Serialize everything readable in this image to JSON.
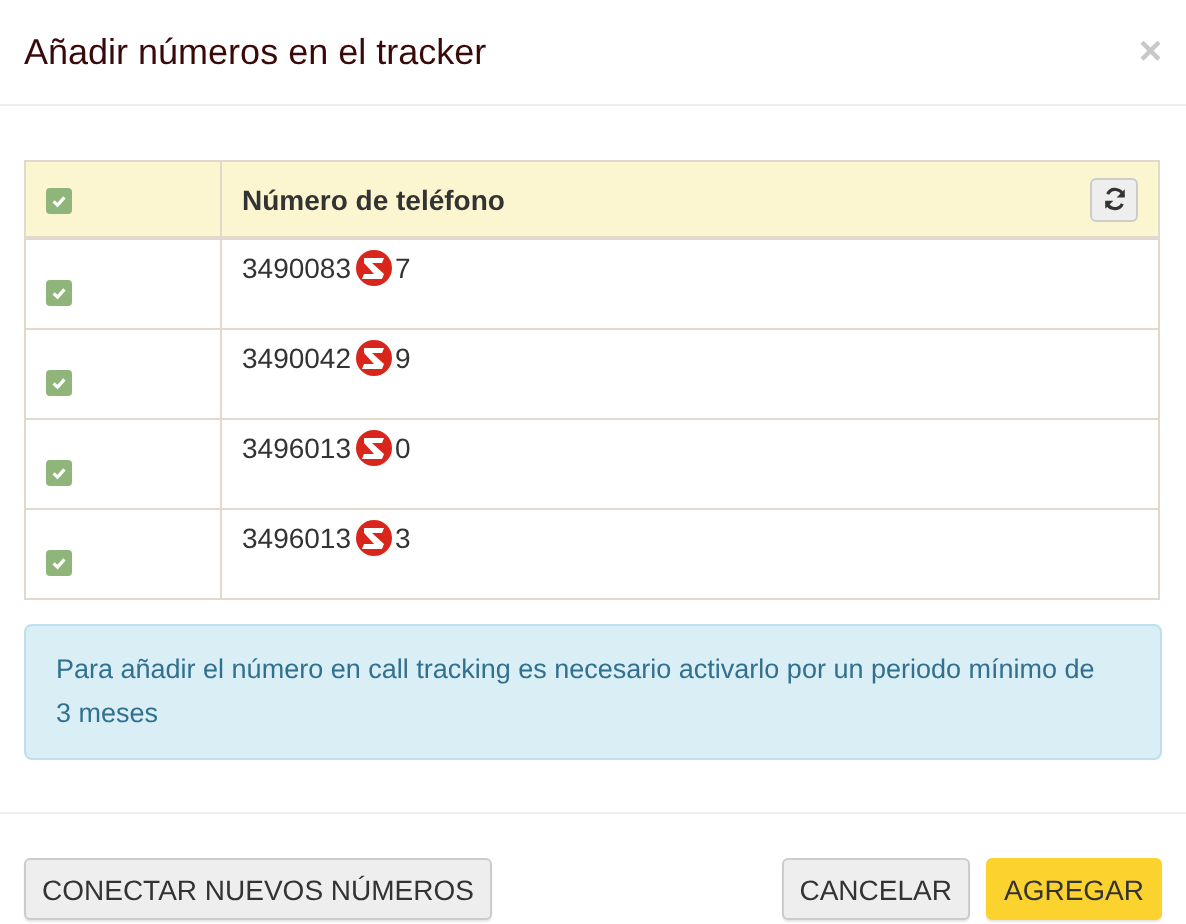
{
  "dialog": {
    "title": "Añadir números en el tracker",
    "close": "×"
  },
  "table": {
    "select_all_checked": true,
    "column_header": "Número de teléfono",
    "rows": [
      {
        "checked": true,
        "number_start": "3490083",
        "number_end": "7"
      },
      {
        "checked": true,
        "number_start": "3490042",
        "number_end": "9"
      },
      {
        "checked": true,
        "number_start": "3496013",
        "number_end": "0"
      },
      {
        "checked": true,
        "number_start": "3496013",
        "number_end": "3"
      }
    ]
  },
  "alert": "Para añadir el número en call tracking es necesario activarlo por un periodo mínimo de 3 meses",
  "buttons": [
    {
      "label": "CONECTAR NUEVOS NÚMEROS",
      "kind": "default"
    },
    {
      "label": "CANCELAR",
      "kind": "default"
    },
    {
      "label": "AGREGAR",
      "kind": "primary"
    }
  ]
}
